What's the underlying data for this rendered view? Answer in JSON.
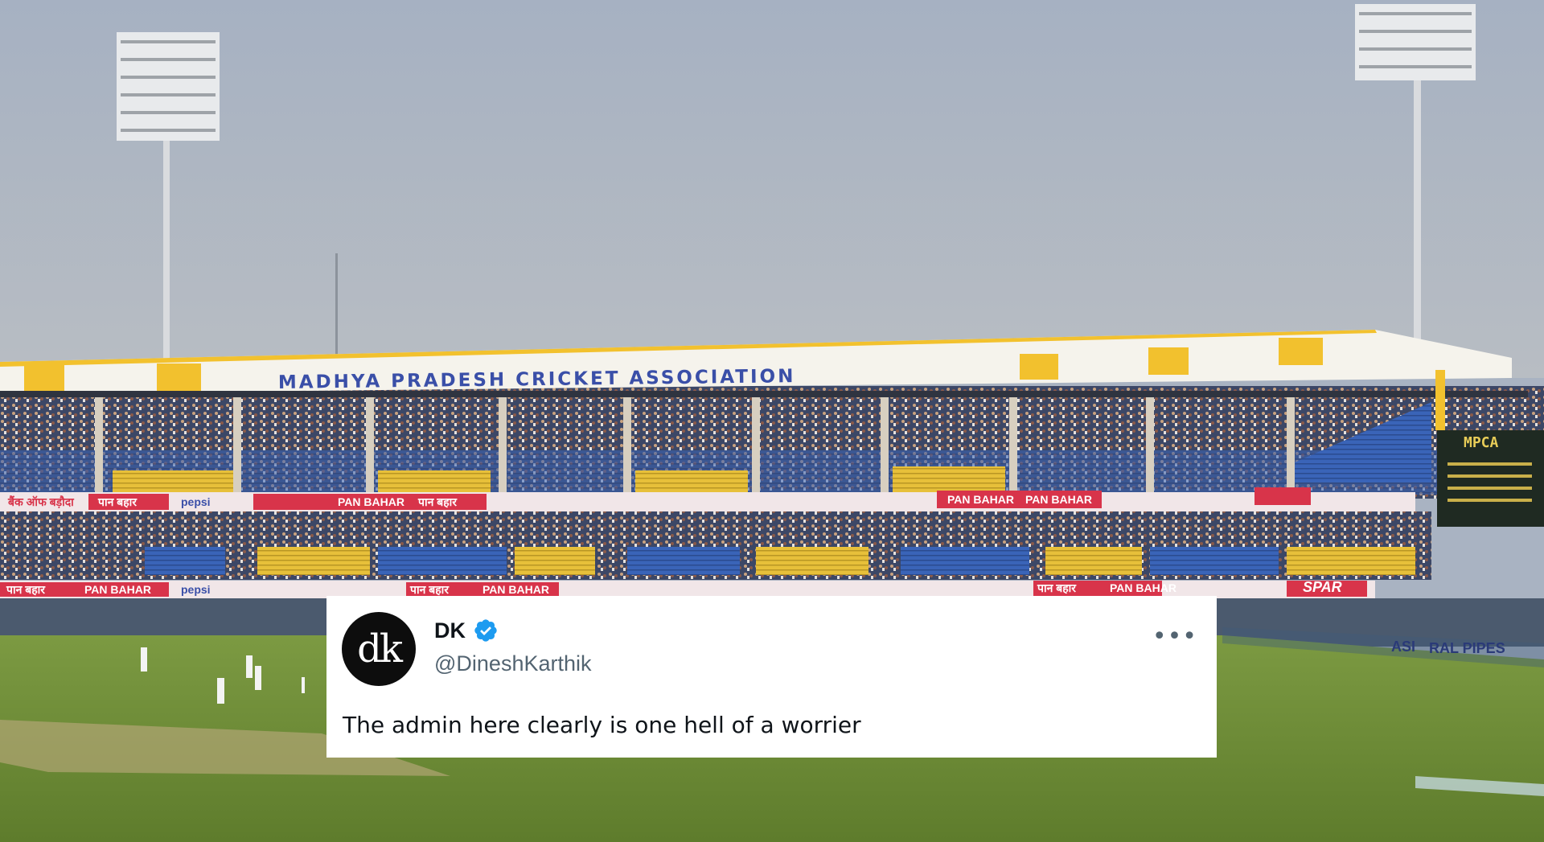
{
  "stadium": {
    "roof_banner": "MADHYA PRADESH CRICKET ASSOCIATION",
    "scoreboard_title": "MPCA",
    "ad_boards_upper": [
      "बैंक ऑफ बड़ौदा",
      "पान बहार",
      "pepsi",
      "PAN BAHAR",
      "पान बहार",
      "PAN BAHAR",
      "PAN BAHAR"
    ],
    "ad_boards_lower": [
      "पान बहार",
      "PAN BAHAR",
      "pepsi",
      "पान बहार",
      "PAN BAHAR",
      "पान बहार",
      "PAN BAHAR",
      "SPAR"
    ],
    "ad_boards_right": [
      "ASI",
      "RAL PIPES"
    ],
    "colors": {
      "sky": "#a9b3c2",
      "roof_yellow": "#f2c12e",
      "roof_white": "#f5f3ec",
      "banner_text": "#3a4fa8",
      "seat_blue": "#3a64b8",
      "seat_yellow": "#e7c03a",
      "ad_red": "#d8344a",
      "grass": "#6b8a33"
    }
  },
  "tweet": {
    "avatar_initials": "dk",
    "display_name": "DK",
    "handle": "@DineshKarthik",
    "text": "The admin here clearly is one hell of a worrier",
    "verified": true,
    "colors": {
      "badge": "#1d9bf0",
      "name": "#0f1419",
      "handle": "#536471"
    }
  }
}
